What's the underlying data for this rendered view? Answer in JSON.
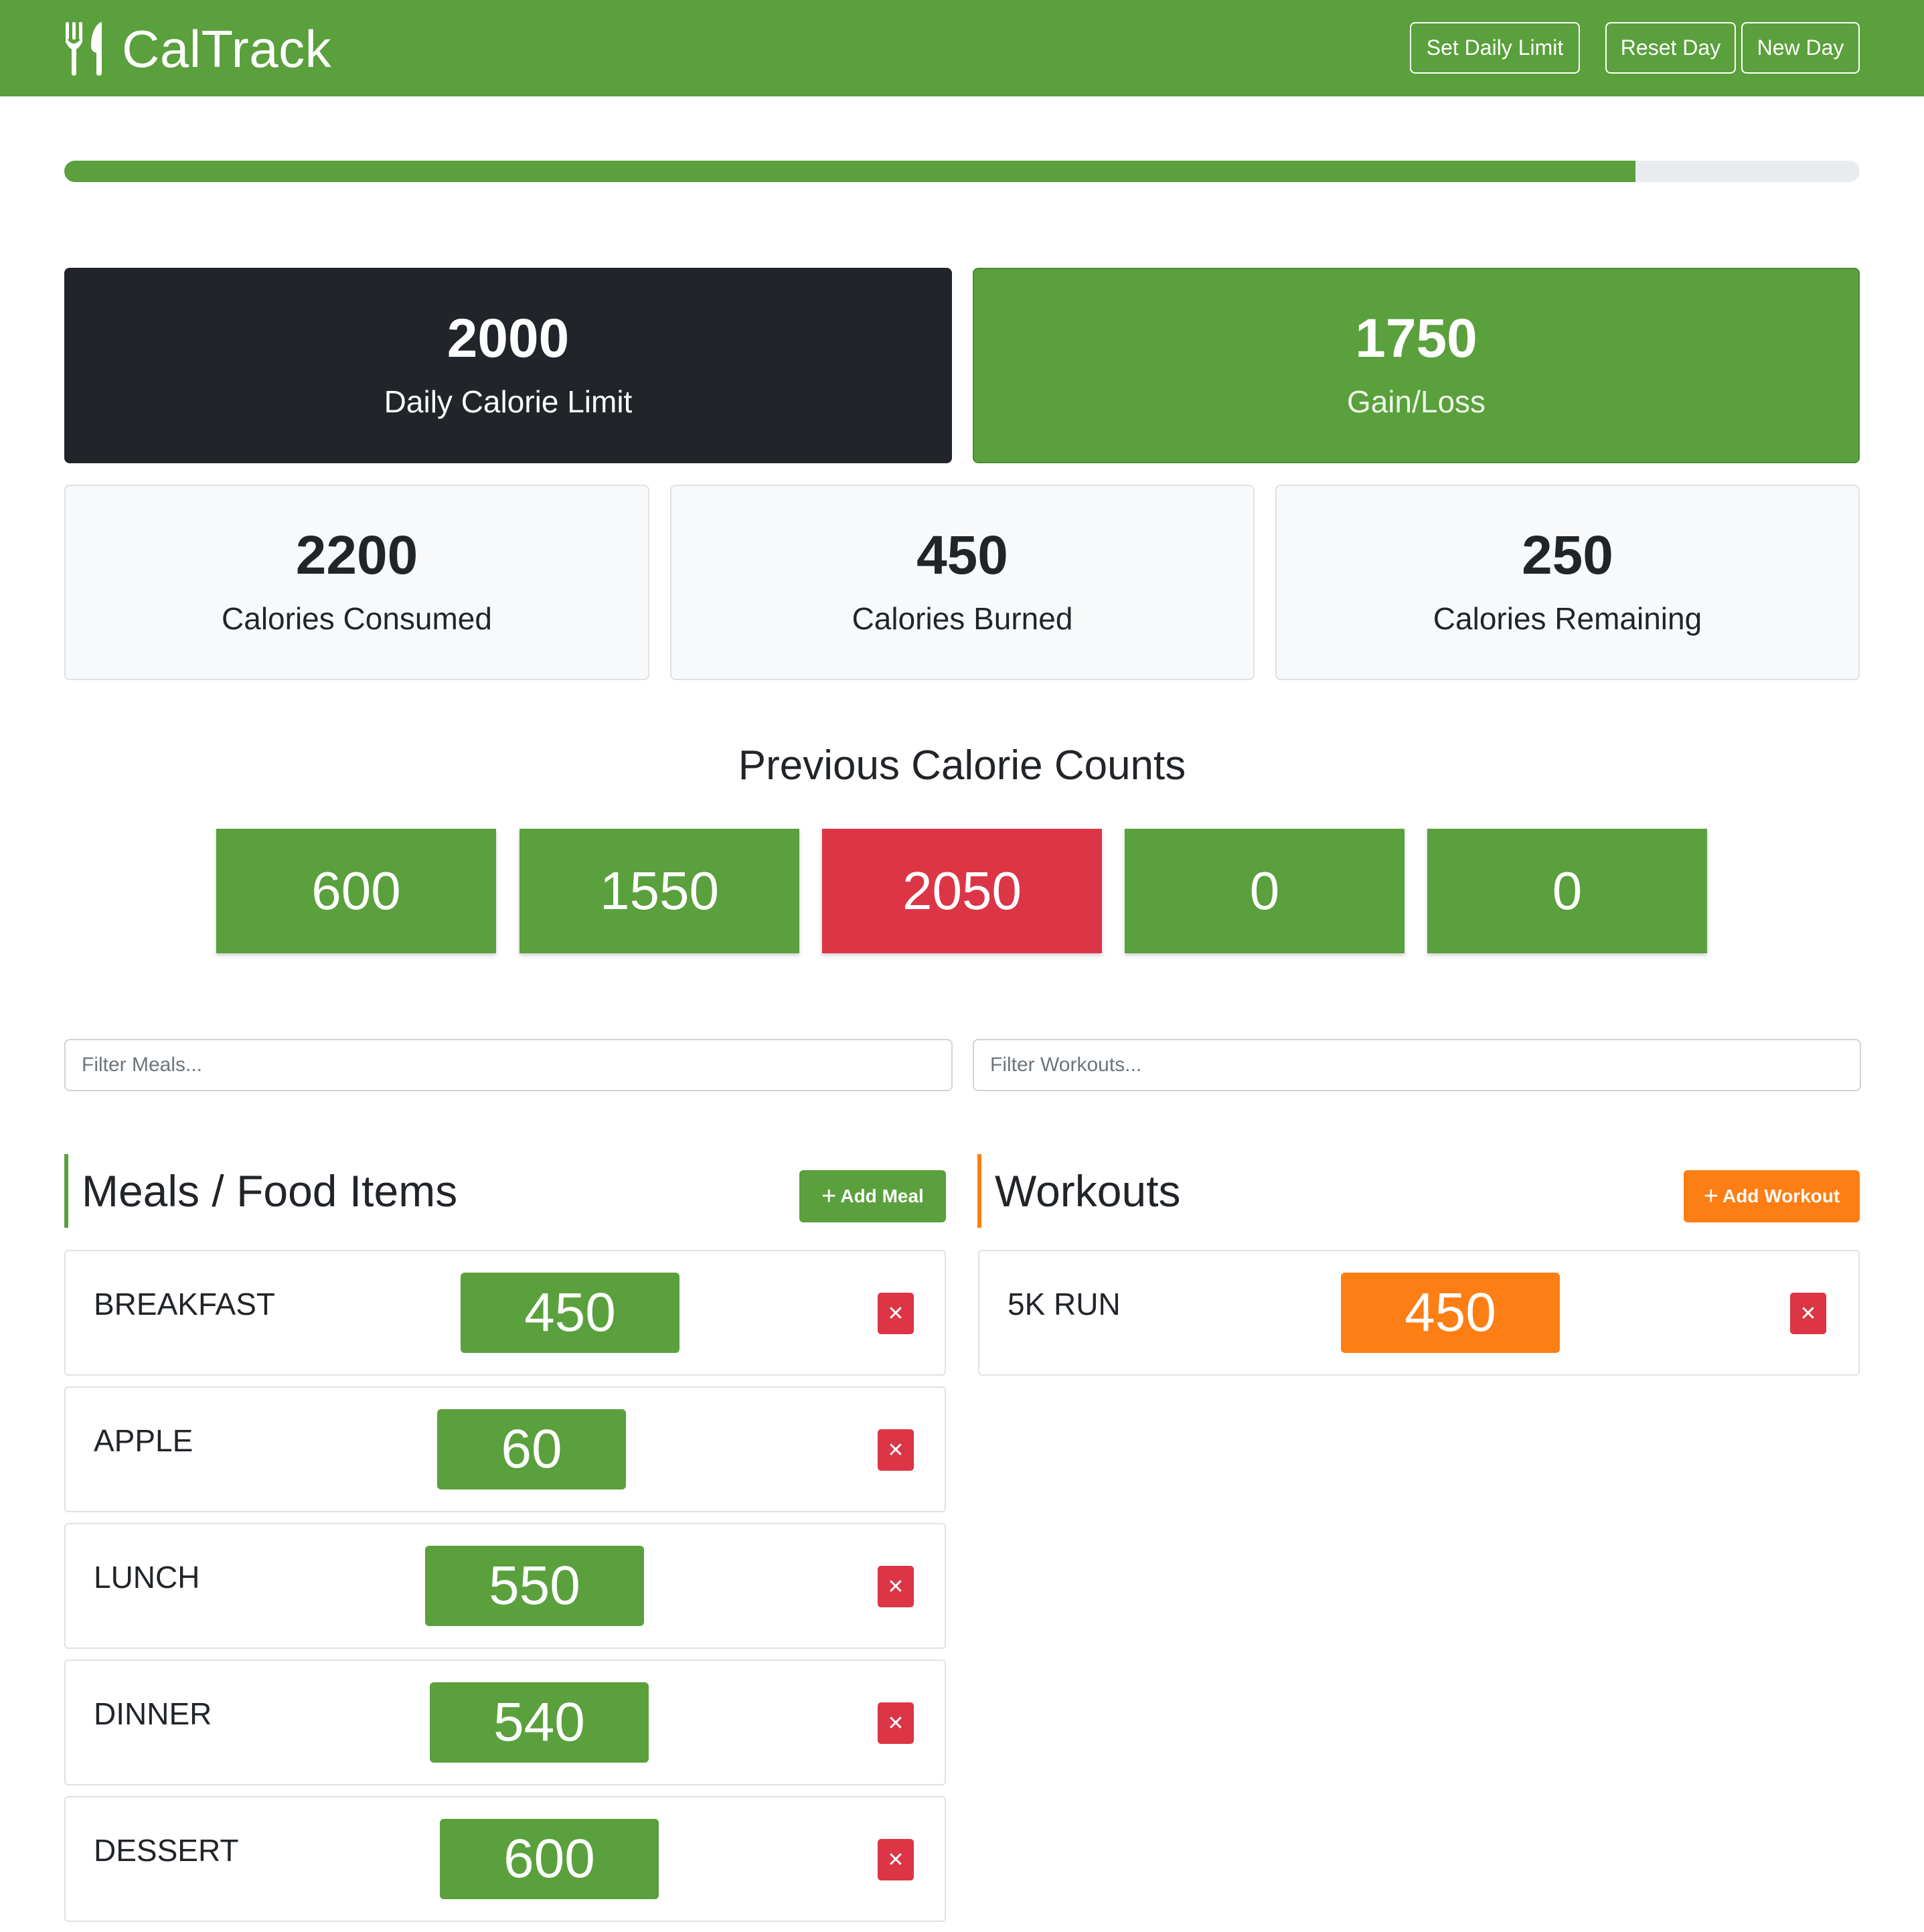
{
  "app": {
    "title": "CalTrack"
  },
  "nav": {
    "set_limit": "Set Daily Limit",
    "reset_day": "Reset Day",
    "new_day": "New Day"
  },
  "progress": {
    "fraction": 0.875
  },
  "stats": {
    "limit": {
      "value": "2000",
      "label": "Daily Calorie Limit"
    },
    "gain_loss": {
      "value": "1750",
      "label": "Gain/Loss"
    },
    "consumed": {
      "value": "2200",
      "label": "Calories Consumed"
    },
    "burned": {
      "value": "450",
      "label": "Calories Burned"
    },
    "remaining": {
      "value": "250",
      "label": "Calories Remaining"
    }
  },
  "previous": {
    "title": "Previous Calorie Counts",
    "counts": [
      {
        "value": "600",
        "status": "under"
      },
      {
        "value": "1550",
        "status": "under"
      },
      {
        "value": "2050",
        "status": "over"
      },
      {
        "value": "0",
        "status": "under"
      },
      {
        "value": "0",
        "status": "under"
      }
    ]
  },
  "filters": {
    "meals_placeholder": "Filter Meals...",
    "workouts_placeholder": "Filter Workouts..."
  },
  "meals": {
    "title": "Meals / Food Items",
    "add_label": "Add Meal",
    "items": [
      {
        "name": "BREAKFAST",
        "calories": "450"
      },
      {
        "name": "APPLE",
        "calories": "60"
      },
      {
        "name": "LUNCH",
        "calories": "550"
      },
      {
        "name": "DINNER",
        "calories": "540"
      },
      {
        "name": "DESSERT",
        "calories": "600"
      }
    ]
  },
  "workouts": {
    "title": "Workouts",
    "add_label": "Add Workout",
    "items": [
      {
        "name": "5K RUN",
        "calories": "450"
      }
    ]
  },
  "icons": {
    "brand": "utensils-icon",
    "add": "plus-icon",
    "delete": "close-icon"
  },
  "colors": {
    "primary": "#5aa03c",
    "dark": "#212529",
    "danger": "#dc3545",
    "workout": "#fd7e14",
    "light": "#f8f9fa"
  }
}
